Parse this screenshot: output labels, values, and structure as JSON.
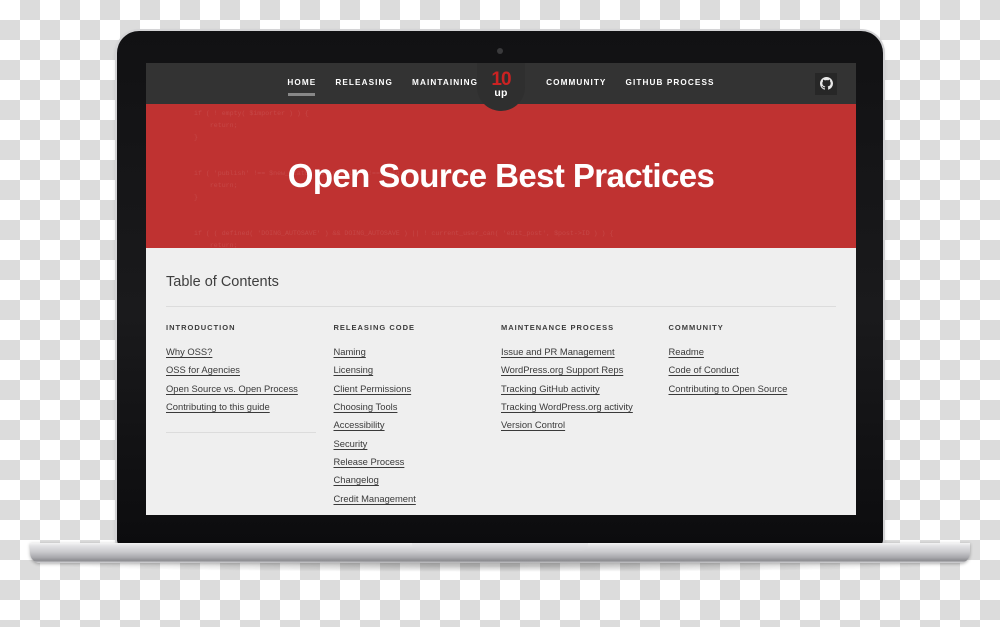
{
  "window": {
    "device": "laptop-mockup"
  },
  "nav": {
    "left_items": [
      {
        "label": "HOME",
        "active": true
      },
      {
        "label": "RELEASING",
        "active": false
      },
      {
        "label": "MAINTAINING",
        "active": false
      }
    ],
    "right_items": [
      {
        "label": "COMMUNITY",
        "active": false
      },
      {
        "label": "GITHUB PROCESS",
        "active": false
      }
    ],
    "logo": {
      "mark": "10",
      "word": "up"
    },
    "icon": "github-icon",
    "bg_color": "#333333",
    "text_color": "#ffffff",
    "active_underline_color": "#888888"
  },
  "hero": {
    "title": "Open Source Best Practices",
    "bg_color": "#bf3231",
    "code_background": "if ( ! empty( $importer ) ) {\n    return;\n}\n\n\nif ( 'publish' !== $new_status && 'publish' !== $old_status ) {\n    return;\n}\n\n\nif ( ( defined( 'DOING_AUTOSAVE' ) && DOING_AUTOSAVE ) || ! current_user_can( 'edit_post', $post->ID ) ) {\n    return;\n}\n"
  },
  "content": {
    "bg_color": "#efefef",
    "toc_heading": "Table of Contents",
    "columns": [
      {
        "heading": "INTRODUCTION",
        "links": [
          "Why OSS?",
          "OSS for Agencies",
          "Open Source vs. Open Process",
          "Contributing to this guide"
        ]
      },
      {
        "heading": "RELEASING CODE",
        "links": [
          "Naming",
          "Licensing",
          "Client Permissions",
          "Choosing Tools",
          "Accessibility",
          "Security",
          "Release Process",
          "Changelog",
          "Credit Management"
        ]
      },
      {
        "heading": "MAINTENANCE PROCESS",
        "links": [
          "Issue and PR Management",
          "WordPress.org Support Reps",
          "Tracking GitHub activity",
          "Tracking WordPress.org activity",
          "Version Control"
        ]
      },
      {
        "heading": "COMMUNITY",
        "links": [
          "Readme",
          "Code of Conduct",
          "Contributing to Open Source"
        ]
      }
    ]
  }
}
